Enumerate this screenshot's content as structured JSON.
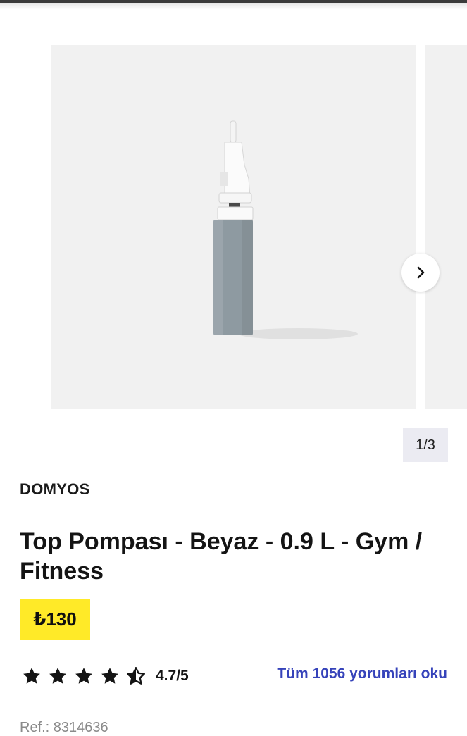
{
  "gallery": {
    "image_alt": "Top Pompası",
    "counter": "1/3",
    "next_icon": "chevron-right-icon"
  },
  "product": {
    "brand": "DOMYOS",
    "title": "Top Pompası - Beyaz - 0.9 L - Gym / Fitness",
    "price": "₺130",
    "price_color": "#ffea28"
  },
  "rating": {
    "value": 4.7,
    "max": 5,
    "display": "4.7/5",
    "stars_icons": [
      "star-full-icon",
      "star-full-icon",
      "star-full-icon",
      "star-full-icon",
      "star-half-icon"
    ],
    "reviews_link": "Tüm 1056 yorumları oku",
    "link_color": "#3643ba"
  },
  "reference": {
    "text": "Ref.: 8314636"
  }
}
